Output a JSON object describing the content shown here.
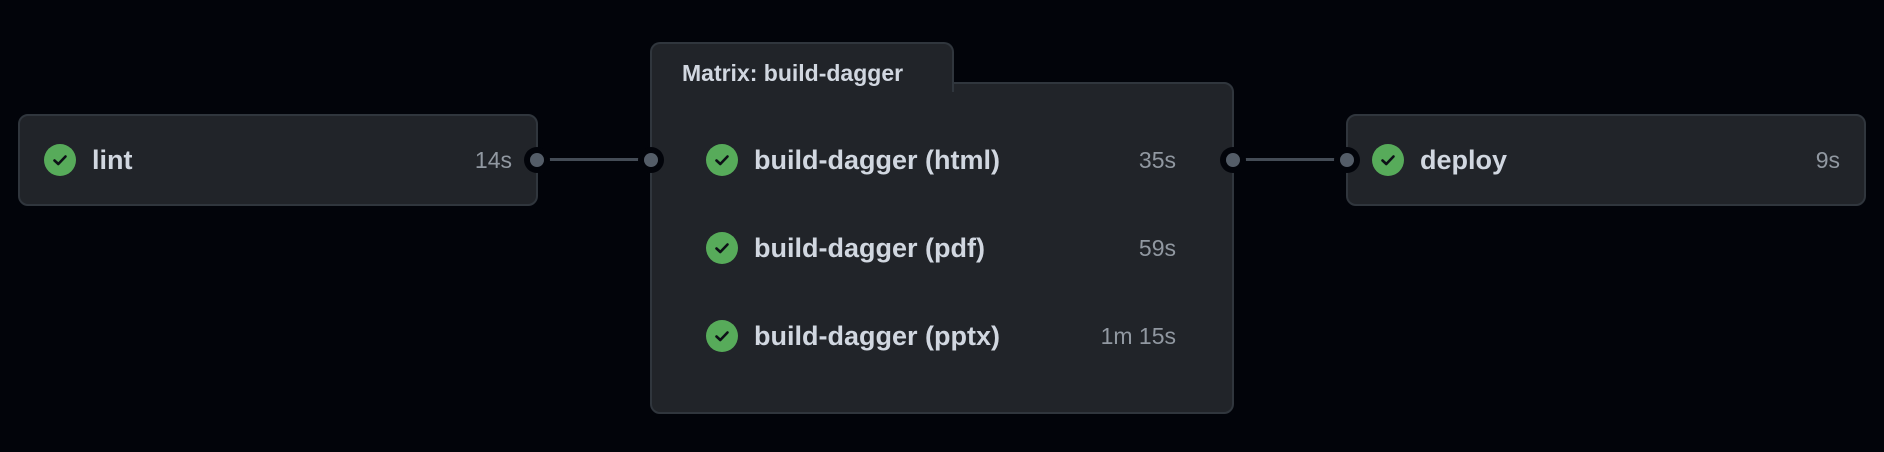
{
  "jobs": {
    "lint": {
      "name": "lint",
      "duration": "14s",
      "status": "success"
    },
    "matrix": {
      "title": "Matrix: build-dagger",
      "items": [
        {
          "name": "build-dagger (html)",
          "duration": "35s",
          "status": "success"
        },
        {
          "name": "build-dagger (pdf)",
          "duration": "59s",
          "status": "success"
        },
        {
          "name": "build-dagger (pptx)",
          "duration": "1m 15s",
          "status": "success"
        }
      ]
    },
    "deploy": {
      "name": "deploy",
      "duration": "9s",
      "status": "success"
    }
  },
  "icons": {
    "status": "check-circle-icon"
  },
  "colors": {
    "background": "#02040a",
    "card": "#212429",
    "border": "#30363d",
    "success": "#57ab5a",
    "text": "#d1d7e0",
    "muted": "#9198a1",
    "connector": "#444c56"
  }
}
